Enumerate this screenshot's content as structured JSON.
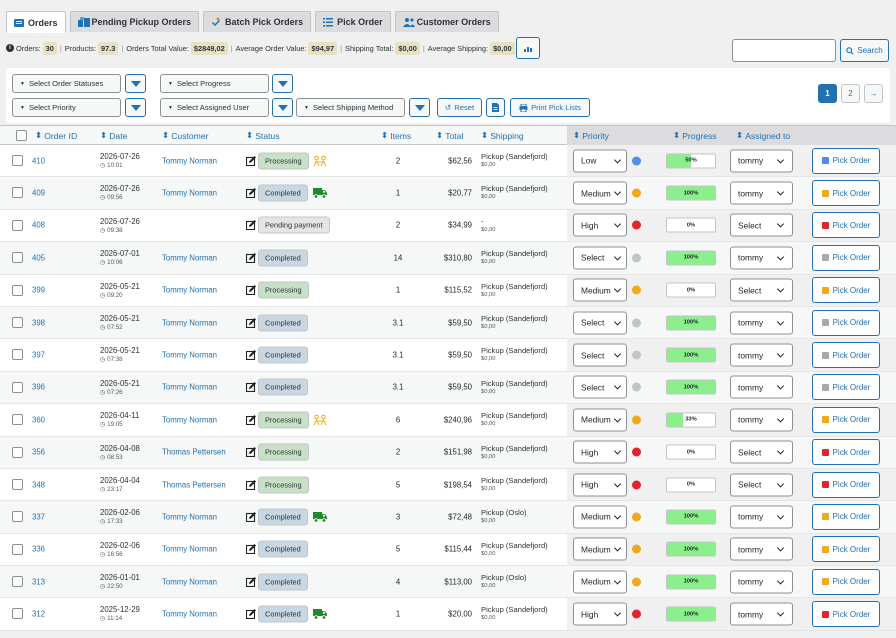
{
  "tabs": [
    {
      "label": "Orders",
      "active": true,
      "icon": "list-icon"
    },
    {
      "label": "Pending Pickup Orders",
      "active": false,
      "icon": "warehouse-icon"
    },
    {
      "label": "Batch Pick Orders",
      "active": false,
      "icon": "hand-icon"
    },
    {
      "label": "Pick Order",
      "active": false,
      "icon": "checklist-icon"
    },
    {
      "label": "Customer Orders",
      "active": false,
      "icon": "users-icon"
    }
  ],
  "summary": {
    "orders_label": "Orders:",
    "orders": "30",
    "products_label": "Products:",
    "products": "97.3",
    "total_label": "Orders Total Value:",
    "total": "$2849,02",
    "avg_label": "Average Order Value:",
    "avg": "$94,97",
    "ship_label": "Shipping Total:",
    "ship": "$0,00",
    "avgship_label": "Average Shipping:",
    "avgship": "$0,00"
  },
  "search": {
    "placeholder": "",
    "button": "Search"
  },
  "filters": {
    "statuses": "Select Order Statuses",
    "progress": "Select Progress",
    "priority": "Select Priority",
    "user": "Select Assigned User",
    "shipping": "Select Shipping Method",
    "reset": "Reset",
    "print": "Print Pick Lists"
  },
  "pagination": {
    "pages": [
      "1",
      "2"
    ],
    "current": "1",
    "next": "→"
  },
  "columns": {
    "id": "Order ID",
    "date": "Date",
    "customer": "Customer",
    "status": "Status",
    "items": "Items",
    "total": "Total",
    "shipping": "Shipping",
    "priority": "Priority",
    "progress": "Progress",
    "assigned": "Assigned to"
  },
  "colors": {
    "accent": "#2271b1",
    "progress_fill": "#8bf08b",
    "prio_low": "#4f8de8",
    "prio_medium": "#f0a81c",
    "prio_high": "#e0262a",
    "prio_none": "#c3c4c7"
  },
  "rows": [
    {
      "id": "410",
      "date": "2026-07-26",
      "time": "10:01",
      "customer": "Tommy Norman",
      "status": "Processing",
      "status_icon": "people-icon",
      "items": "2",
      "total": "$62,56",
      "ship": "Pickup (Sandefjord)",
      "ship_cost": "$0,00",
      "priority": "Low",
      "progress": "50%",
      "progress_value": 0.5,
      "user": "tommy",
      "pick": "Pick Order"
    },
    {
      "id": "409",
      "date": "2026-07-26",
      "time": "09:56",
      "customer": "Tommy Norman",
      "status": "Completed",
      "status_icon": "truck-icon",
      "items": "1",
      "total": "$20,77",
      "ship": "Pickup (Sandefjord)",
      "ship_cost": "$0,00",
      "priority": "Medium",
      "progress": "100%",
      "progress_value": 1,
      "user": "tommy",
      "pick": "Pick Order"
    },
    {
      "id": "408",
      "date": "2026-07-26",
      "time": "09:38",
      "customer": "",
      "status": "Pending payment",
      "status_icon": "",
      "items": "2",
      "total": "$34,99",
      "ship": "-",
      "ship_cost": "$0,00",
      "priority": "High",
      "progress": "0%",
      "progress_value": 0,
      "user": "Select",
      "pick": "Pick Order"
    },
    {
      "id": "405",
      "date": "2026-07-01",
      "time": "10:06",
      "customer": "Tommy Norman",
      "status": "Completed",
      "status_icon": "",
      "items": "14",
      "total": "$310,80",
      "ship": "Pickup (Sandefjord)",
      "ship_cost": "$0,00",
      "priority": "Select",
      "progress": "100%",
      "progress_value": 1,
      "user": "tommy",
      "pick": "Pick Order"
    },
    {
      "id": "399",
      "date": "2026-05-21",
      "time": "09:20",
      "customer": "Tommy Norman",
      "status": "Processing",
      "status_icon": "",
      "items": "1",
      "total": "$115,52",
      "ship": "Pickup (Sandefjord)",
      "ship_cost": "$0,00",
      "priority": "Medium",
      "progress": "0%",
      "progress_value": 0,
      "user": "Select",
      "pick": "Pick Order"
    },
    {
      "id": "398",
      "date": "2026-05-21",
      "time": "07:52",
      "customer": "Tommy Norman",
      "status": "Completed",
      "status_icon": "",
      "items": "3.1",
      "total": "$59,50",
      "ship": "Pickup (Sandefjord)",
      "ship_cost": "$0,00",
      "priority": "Select",
      "progress": "100%",
      "progress_value": 1,
      "user": "tommy",
      "pick": "Pick Order"
    },
    {
      "id": "397",
      "date": "2026-05-21",
      "time": "07:38",
      "customer": "Tommy Norman",
      "status": "Completed",
      "status_icon": "",
      "items": "3.1",
      "total": "$59,50",
      "ship": "Pickup (Sandefjord)",
      "ship_cost": "$0,00",
      "priority": "Select",
      "progress": "100%",
      "progress_value": 1,
      "user": "tommy",
      "pick": "Pick Order"
    },
    {
      "id": "396",
      "date": "2026-05-21",
      "time": "07:26",
      "customer": "Tommy Norman",
      "status": "Completed",
      "status_icon": "",
      "items": "3.1",
      "total": "$59,50",
      "ship": "Pickup (Sandefjord)",
      "ship_cost": "$0,00",
      "priority": "Select",
      "progress": "100%",
      "progress_value": 1,
      "user": "tommy",
      "pick": "Pick Order"
    },
    {
      "id": "360",
      "date": "2026-04-11",
      "time": "19:05",
      "customer": "Tommy Norman",
      "status": "Processing",
      "status_icon": "people-icon",
      "items": "6",
      "total": "$240,96",
      "ship": "Pickup (Sandefjord)",
      "ship_cost": "$0,00",
      "priority": "Medium",
      "progress": "33%",
      "progress_value": 0.33,
      "user": "tommy",
      "pick": "Pick Order"
    },
    {
      "id": "356",
      "date": "2026-04-08",
      "time": "08:53",
      "customer": "Thomas Pettersen",
      "status": "Processing",
      "status_icon": "",
      "items": "2",
      "total": "$151,98",
      "ship": "Pickup (Sandefjord)",
      "ship_cost": "$0,00",
      "priority": "High",
      "progress": "0%",
      "progress_value": 0,
      "user": "Select",
      "pick": "Pick Order"
    },
    {
      "id": "348",
      "date": "2026-04-04",
      "time": "23:17",
      "customer": "Thomas Pettersen",
      "status": "Processing",
      "status_icon": "",
      "items": "5",
      "total": "$198,54",
      "ship": "Pickup (Sandefjord)",
      "ship_cost": "$0,00",
      "priority": "High",
      "progress": "0%",
      "progress_value": 0,
      "user": "Select",
      "pick": "Pick Order"
    },
    {
      "id": "337",
      "date": "2026-02-06",
      "time": "17:33",
      "customer": "Tommy Norman",
      "status": "Completed",
      "status_icon": "truck-icon",
      "items": "3",
      "total": "$72,48",
      "ship": "Pickup (Oslo)",
      "ship_cost": "$0,00",
      "priority": "Medium",
      "progress": "100%",
      "progress_value": 1,
      "user": "tommy",
      "pick": "Pick Order"
    },
    {
      "id": "336",
      "date": "2026-02-06",
      "time": "16:56",
      "customer": "Tommy Norman",
      "status": "Completed",
      "status_icon": "",
      "items": "5",
      "total": "$115,44",
      "ship": "Pickup (Sandefjord)",
      "ship_cost": "$0,00",
      "priority": "Medium",
      "progress": "100%",
      "progress_value": 1,
      "user": "tommy",
      "pick": "Pick Order"
    },
    {
      "id": "313",
      "date": "2026-01-01",
      "time": "22:50",
      "customer": "Tommy Norman",
      "status": "Completed",
      "status_icon": "",
      "items": "4",
      "total": "$113,00",
      "ship": "Pickup (Oslo)",
      "ship_cost": "$0,00",
      "priority": "Medium",
      "progress": "100%",
      "progress_value": 1,
      "user": "tommy",
      "pick": "Pick Order"
    },
    {
      "id": "312",
      "date": "2025-12-29",
      "time": "11:14",
      "customer": "Tommy Norman",
      "status": "Completed",
      "status_icon": "truck-icon",
      "items": "1",
      "total": "$20,00",
      "ship": "Pickup (Sandefjord)",
      "ship_cost": "$0,00",
      "priority": "High",
      "progress": "100%",
      "progress_value": 1,
      "user": "tommy",
      "pick": "Pick Order"
    }
  ]
}
